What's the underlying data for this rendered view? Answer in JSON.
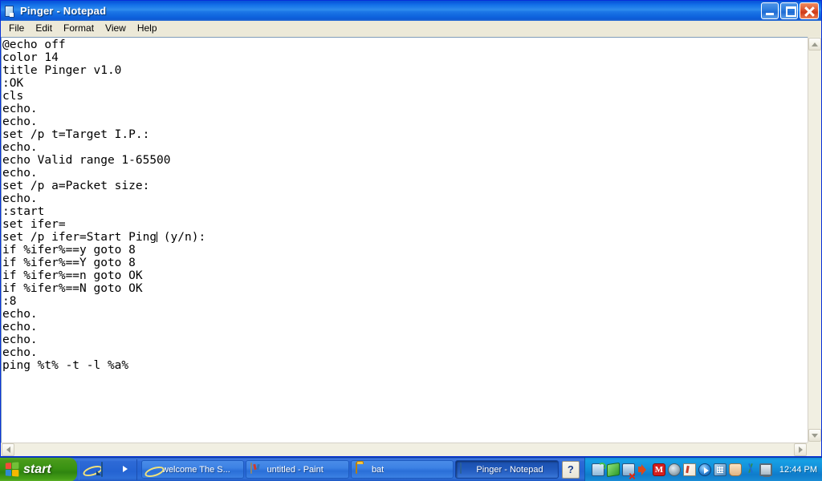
{
  "window": {
    "title": "Pinger - Notepad",
    "icon": "notepad-icon",
    "buttons": {
      "minimize": "Minimize",
      "restore": "Restore",
      "close": "Close"
    },
    "menu": [
      {
        "label": "File"
      },
      {
        "label": "Edit"
      },
      {
        "label": "Format"
      },
      {
        "label": "View"
      },
      {
        "label": "Help"
      }
    ]
  },
  "editor": {
    "lines": [
      "@echo off",
      "color 14",
      "title Pinger v1.0",
      ":OK",
      "cls",
      "echo.",
      "echo.",
      "set /p t=Target I.P.:",
      "echo.",
      "echo Valid range 1-65500",
      "echo.",
      "set /p a=Packet size:",
      "echo.",
      ":start",
      "set ifer=",
      "",
      "if %ifer%==y goto 8",
      "if %ifer%==Y goto 8",
      "if %ifer%==n goto OK",
      "if %ifer%==N goto OK",
      ":8",
      "echo.",
      "echo.",
      "echo.",
      "echo.",
      "ping %t% -t -l %a%"
    ],
    "caret_line_index": 15,
    "caret_line_before": "set /p ifer=Start Ping",
    "caret_line_after": " (y/n):"
  },
  "scrollbars": {
    "vertical_up": "Scroll up",
    "vertical_down": "Scroll down",
    "horizontal_left": "Scroll left",
    "horizontal_right": "Scroll right"
  },
  "taskbar": {
    "start_label": "start",
    "quick_launch": [
      {
        "name": "internet-explorer-icon"
      },
      {
        "name": "show-desktop-icon"
      },
      {
        "name": "windows-media-player-icon"
      }
    ],
    "tasks": [
      {
        "label": "welcome The S...",
        "icon": "internet-explorer-icon",
        "active": false
      },
      {
        "label": "untitled - Paint",
        "icon": "paint-icon",
        "active": false
      },
      {
        "label": "bat",
        "icon": "folder-icon",
        "active": false
      },
      {
        "label": "Pinger - Notepad",
        "icon": "notepad-icon",
        "active": true
      }
    ],
    "help_button": "?",
    "tray_icons": [
      {
        "name": "network-connection-icon"
      },
      {
        "name": "green-sync-icon"
      },
      {
        "name": "network-disconnected-icon"
      },
      {
        "name": "volume-icon"
      },
      {
        "name": "mcafee-icon",
        "label": "M"
      },
      {
        "name": "disc-icon"
      },
      {
        "name": "notepad-tray-icon"
      },
      {
        "name": "media-play-icon"
      },
      {
        "name": "grid-app-icon"
      },
      {
        "name": "hand-tool-icon"
      },
      {
        "name": "scissors-icon"
      },
      {
        "name": "monitor-icon"
      }
    ],
    "clock": "12:44 PM"
  },
  "colors": {
    "titlebar_blue": "#0a5ade",
    "menubar_beige": "#ece9d8",
    "taskbar_blue": "#2463d2",
    "start_green": "#399212",
    "close_red": "#cf3a18",
    "editor_bg": "#ffffff",
    "text_black": "#000000"
  }
}
